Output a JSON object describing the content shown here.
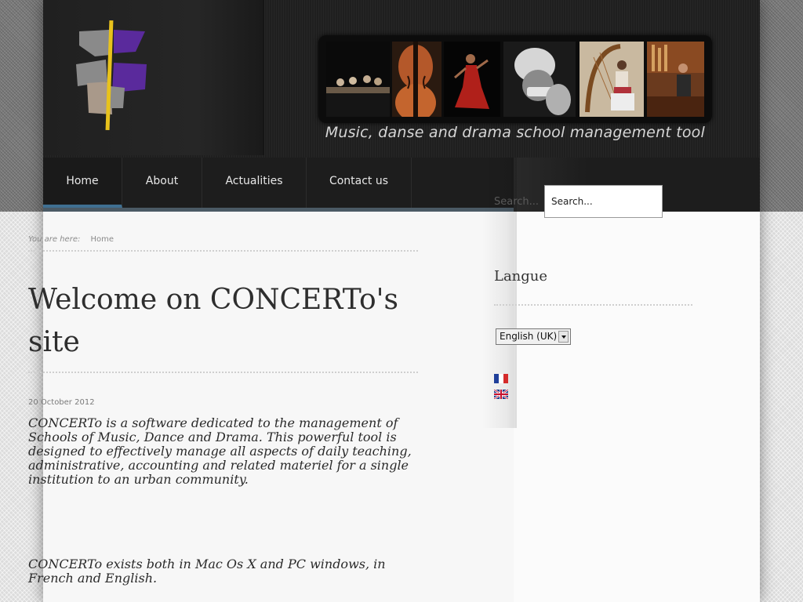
{
  "header": {
    "tagline": "Music, danse and drama school management tool",
    "photos": [
      "orchestra",
      "violin",
      "dancer",
      "harmonica-player",
      "harpist",
      "organist"
    ]
  },
  "nav": {
    "items": [
      {
        "label": "Home",
        "active": true
      },
      {
        "label": "About",
        "active": false
      },
      {
        "label": "Actualities",
        "active": false
      },
      {
        "label": "Contact us",
        "active": false
      }
    ]
  },
  "search": {
    "ghost_label": "Search...",
    "placeholder": "Search...",
    "value": "Search..."
  },
  "breadcrumb": {
    "you_are_here": "You are here:",
    "current": "Home"
  },
  "article": {
    "title": "Welcome on CONCERTo's site",
    "date": "20 October 2012",
    "paragraph_1": "CONCERTo is a software dedicated to the management of Schools of Music, Dance and Drama. This powerful tool is designed to effectively manage all aspects of daily teaching, administrative, accounting and related materiel for a single institution to an urban community.",
    "paragraph_2": "CONCERTo exists both in Mac Os X and PC windows, in French and English."
  },
  "sidebar": {
    "language_heading": "Langue",
    "language_selected": "English (UK)",
    "flags": [
      "flag-fr-icon",
      "flag-uk-icon"
    ]
  },
  "colors": {
    "nav_accent": "#3f6f91",
    "logo_purple": "#5a2a9c",
    "logo_yellow": "#e8c21c"
  }
}
